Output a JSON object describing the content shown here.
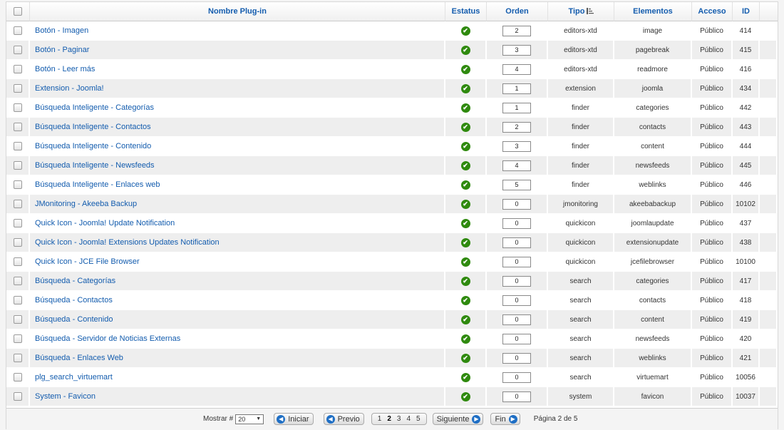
{
  "columns": {
    "name": "Nombre Plug-in",
    "status": "Estatus",
    "order": "Orden",
    "type": "Tipo",
    "element": "Elementos",
    "access": "Acceso",
    "id": "ID"
  },
  "rows": [
    {
      "name": "Botón - Imagen",
      "order": "2",
      "type": "editors-xtd",
      "element": "image",
      "access": "Público",
      "id": "414"
    },
    {
      "name": "Botón - Paginar",
      "order": "3",
      "type": "editors-xtd",
      "element": "pagebreak",
      "access": "Público",
      "id": "415"
    },
    {
      "name": "Botón - Leer más",
      "order": "4",
      "type": "editors-xtd",
      "element": "readmore",
      "access": "Público",
      "id": "416"
    },
    {
      "name": "Extension - Joomla!",
      "order": "1",
      "type": "extension",
      "element": "joomla",
      "access": "Público",
      "id": "434"
    },
    {
      "name": "Búsqueda Inteligente - Categorías",
      "order": "1",
      "type": "finder",
      "element": "categories",
      "access": "Público",
      "id": "442"
    },
    {
      "name": "Búsqueda Inteligente - Contactos",
      "order": "2",
      "type": "finder",
      "element": "contacts",
      "access": "Público",
      "id": "443"
    },
    {
      "name": "Búsqueda Inteligente - Contenido",
      "order": "3",
      "type": "finder",
      "element": "content",
      "access": "Público",
      "id": "444"
    },
    {
      "name": "Búsqueda Inteligente - Newsfeeds",
      "order": "4",
      "type": "finder",
      "element": "newsfeeds",
      "access": "Público",
      "id": "445"
    },
    {
      "name": "Búsqueda Inteligente - Enlaces web",
      "order": "5",
      "type": "finder",
      "element": "weblinks",
      "access": "Público",
      "id": "446"
    },
    {
      "name": "JMonitoring - Akeeba Backup",
      "order": "0",
      "type": "jmonitoring",
      "element": "akeebabackup",
      "access": "Público",
      "id": "10102"
    },
    {
      "name": "Quick Icon - Joomla! Update Notification",
      "order": "0",
      "type": "quickicon",
      "element": "joomlaupdate",
      "access": "Público",
      "id": "437"
    },
    {
      "name": "Quick Icon - Joomla! Extensions Updates Notification",
      "order": "0",
      "type": "quickicon",
      "element": "extensionupdate",
      "access": "Público",
      "id": "438"
    },
    {
      "name": "Quick Icon - JCE File Browser",
      "order": "0",
      "type": "quickicon",
      "element": "jcefilebrowser",
      "access": "Público",
      "id": "10100"
    },
    {
      "name": "Búsqueda - Categorías",
      "order": "0",
      "type": "search",
      "element": "categories",
      "access": "Público",
      "id": "417"
    },
    {
      "name": "Búsqueda - Contactos",
      "order": "0",
      "type": "search",
      "element": "contacts",
      "access": "Público",
      "id": "418"
    },
    {
      "name": "Búsqueda - Contenido",
      "order": "0",
      "type": "search",
      "element": "content",
      "access": "Público",
      "id": "419"
    },
    {
      "name": "Búsqueda - Servidor de Noticias Externas",
      "order": "0",
      "type": "search",
      "element": "newsfeeds",
      "access": "Público",
      "id": "420"
    },
    {
      "name": "Búsqueda - Enlaces Web",
      "order": "0",
      "type": "search",
      "element": "weblinks",
      "access": "Público",
      "id": "421"
    },
    {
      "name": "plg_search_virtuemart",
      "order": "0",
      "type": "search",
      "element": "virtuemart",
      "access": "Público",
      "id": "10056"
    },
    {
      "name": "System - Favicon",
      "order": "0",
      "type": "system",
      "element": "favicon",
      "access": "Público",
      "id": "10037"
    }
  ],
  "pagination": {
    "show_label": "Mostrar #",
    "limit": "20",
    "start": "Iniciar",
    "prev": "Previo",
    "pages": [
      "1",
      "2",
      "3",
      "4",
      "5"
    ],
    "current": "2",
    "next": "Siguiente",
    "end": "Fin",
    "page_info": "Página 2 de 5"
  },
  "colors": {
    "link": "#135cae",
    "enabled": "#2f8a0e",
    "nav_arrow": "#1f6fc5"
  },
  "icons": {
    "status": "check-circle-icon",
    "sort": "sort-ascending-icon",
    "prev": "arrow-left-circle-icon",
    "next": "arrow-right-circle-icon"
  }
}
